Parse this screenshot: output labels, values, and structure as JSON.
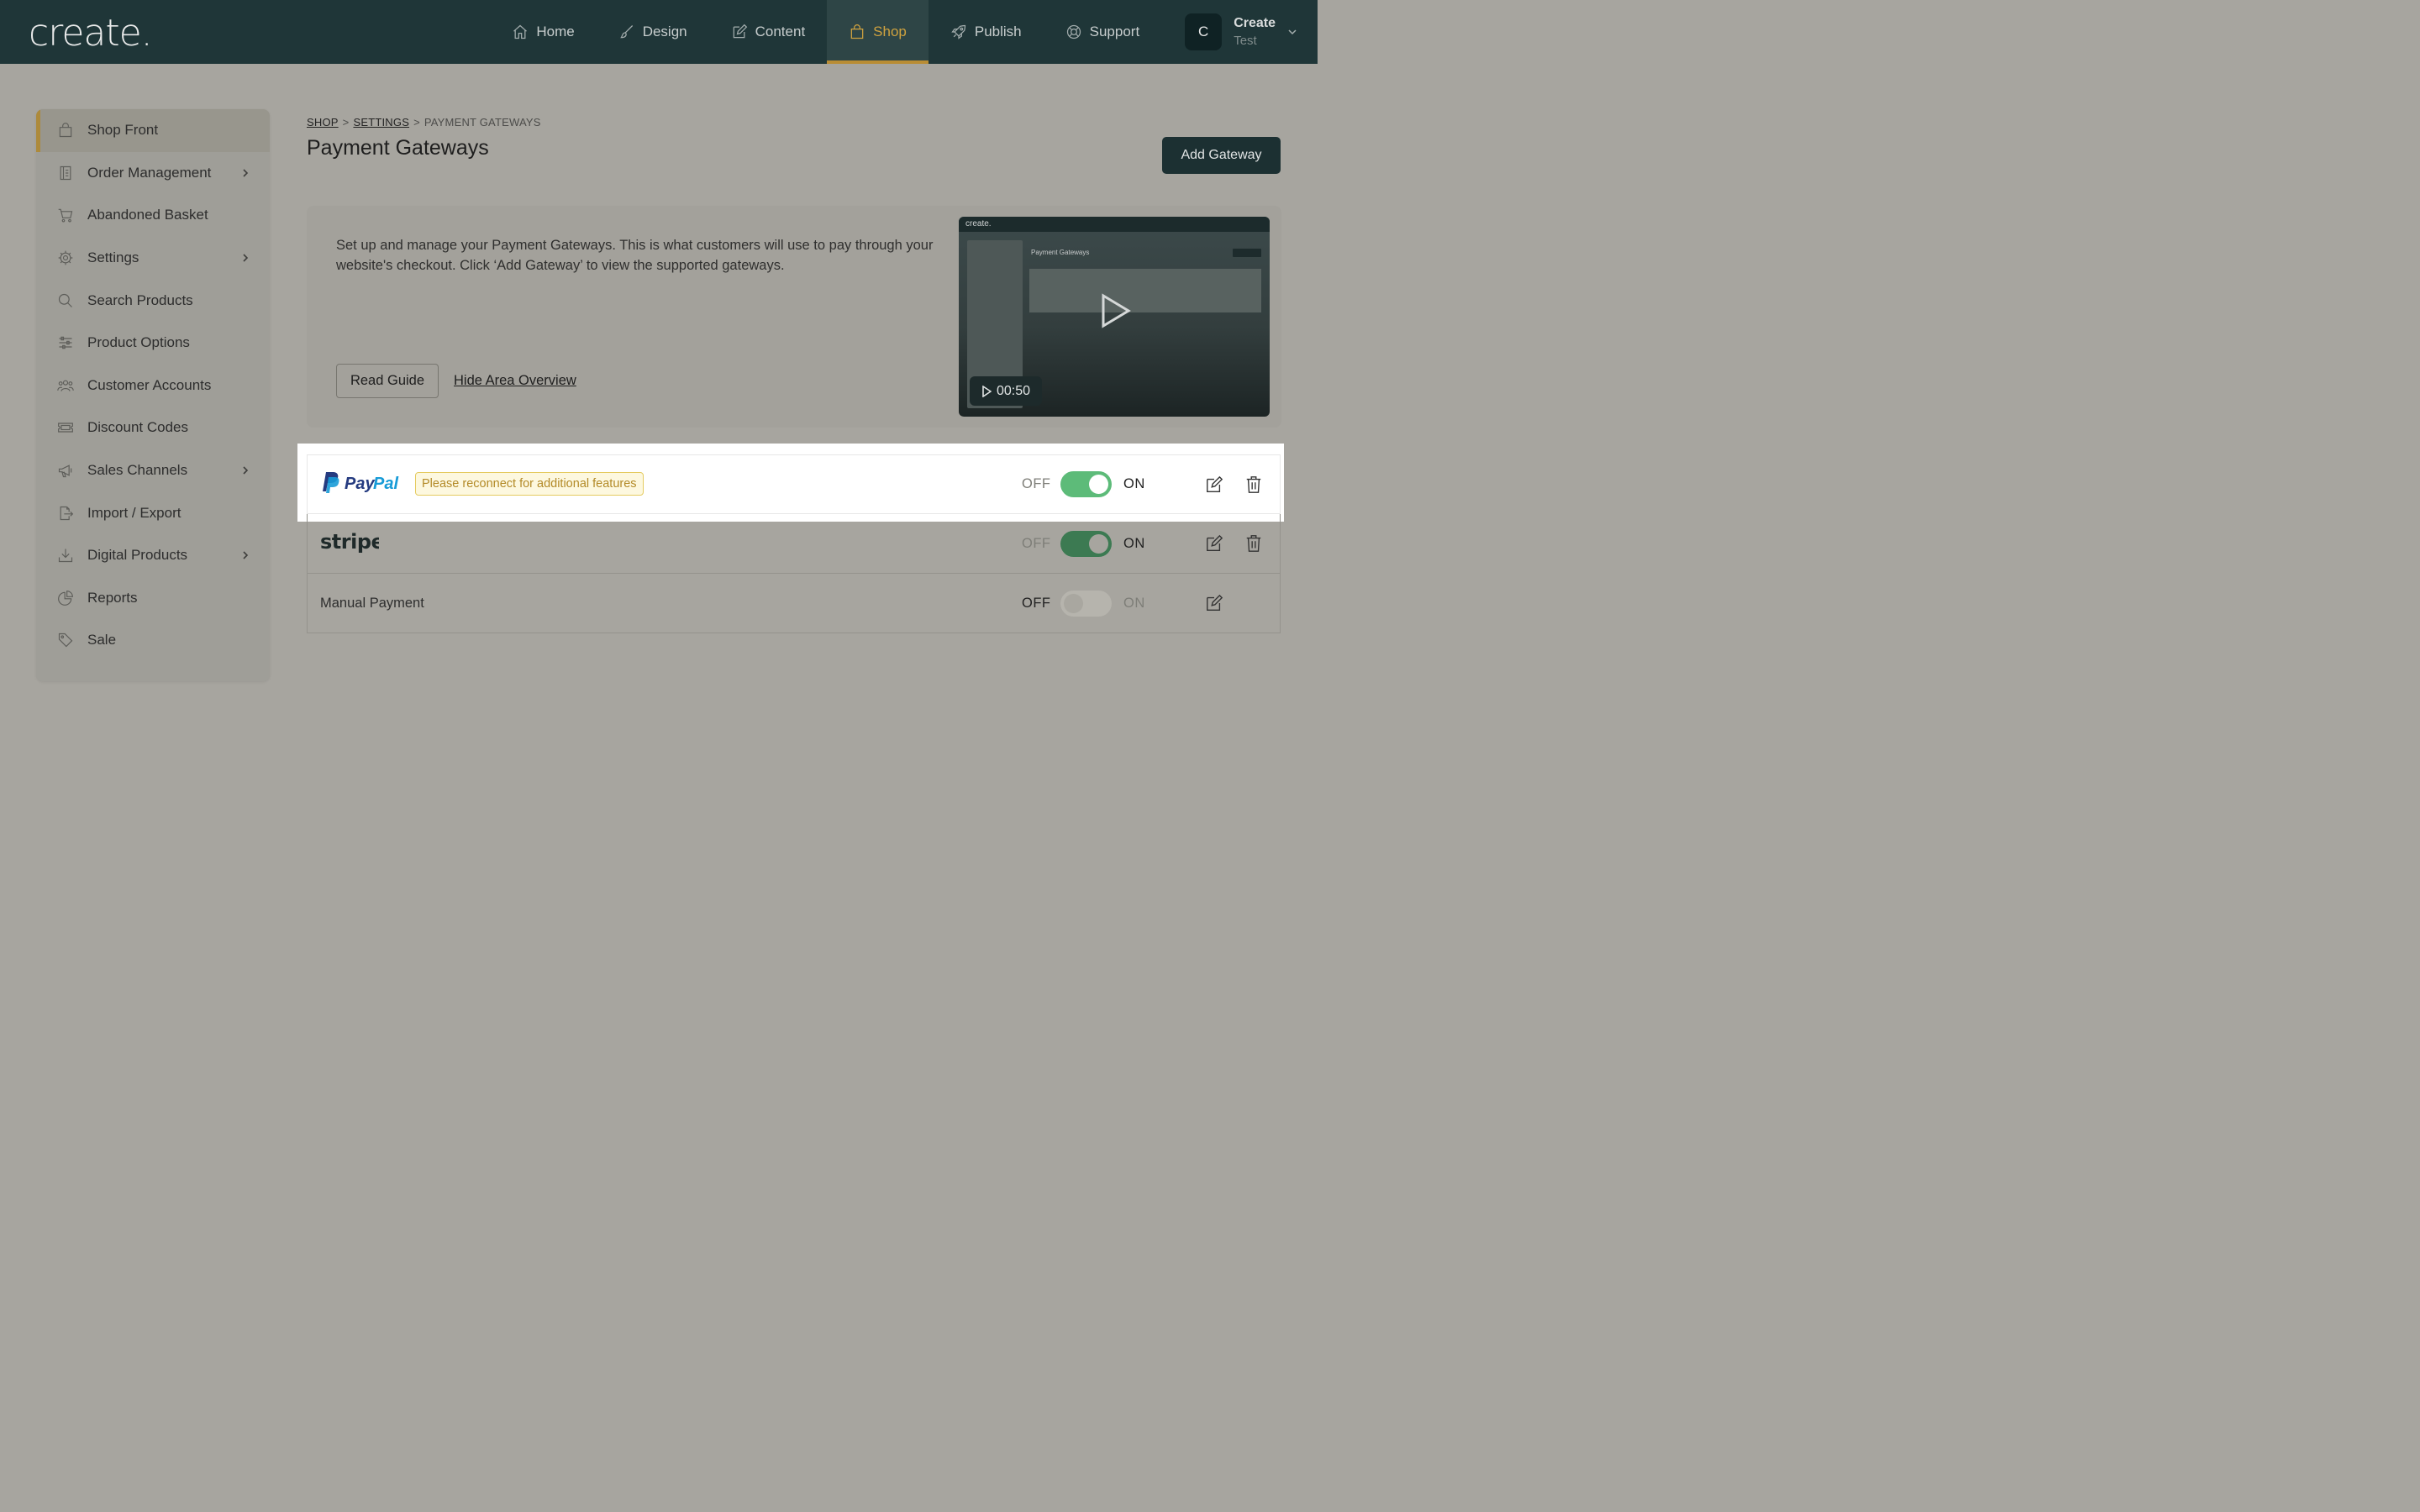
{
  "app": {
    "logo": "create."
  },
  "nav": {
    "items": [
      {
        "label": "Home",
        "icon": "home-icon"
      },
      {
        "label": "Design",
        "icon": "brush-icon"
      },
      {
        "label": "Content",
        "icon": "edit-icon"
      },
      {
        "label": "Shop",
        "icon": "shopping-bag-icon",
        "active": true
      },
      {
        "label": "Publish",
        "icon": "rocket-icon"
      },
      {
        "label": "Support",
        "icon": "lifebuoy-icon"
      }
    ],
    "account": {
      "initial": "C",
      "name": "Create",
      "sub": "Test"
    }
  },
  "sidebar": {
    "items": [
      {
        "label": "Shop Front",
        "icon": "shopping-bag-icon",
        "active": true
      },
      {
        "label": "Order Management",
        "icon": "ledger-icon",
        "chevron": true
      },
      {
        "label": "Abandoned Basket",
        "icon": "cart-icon"
      },
      {
        "label": "Settings",
        "icon": "gear-icon",
        "chevron": true
      },
      {
        "label": "Search Products",
        "icon": "search-icon"
      },
      {
        "label": "Product Options",
        "icon": "sliders-icon"
      },
      {
        "label": "Customer Accounts",
        "icon": "users-icon"
      },
      {
        "label": "Discount Codes",
        "icon": "ticket-icon"
      },
      {
        "label": "Sales Channels",
        "icon": "megaphone-icon",
        "chevron": true
      },
      {
        "label": "Import / Export",
        "icon": "file-export-icon"
      },
      {
        "label": "Digital Products",
        "icon": "download-icon",
        "chevron": true
      },
      {
        "label": "Reports",
        "icon": "pie-chart-icon"
      },
      {
        "label": "Sale",
        "icon": "tag-icon"
      }
    ]
  },
  "breadcrumb": {
    "shop": "SHOP",
    "settings": "SETTINGS",
    "current": "PAYMENT GATEWAYS",
    "sep": ">"
  },
  "page": {
    "title": "Payment Gateways",
    "add_button": "Add Gateway"
  },
  "overview": {
    "text": "Set up and manage your Payment Gateways. This is what customers will use to pay through your website's checkout. Click ‘Add Gateway’ to view the supported gateways.",
    "read_guide": "Read Guide",
    "hide_link": "Hide Area Overview",
    "video": {
      "duration": "00:50",
      "mini_logo": "create.",
      "mini_title": "Payment Gateways"
    }
  },
  "gateways": [
    {
      "name": "PayPal",
      "logo": "paypal-logo",
      "notice": "Please reconnect for additional features",
      "enabled": true,
      "off": "OFF",
      "on": "ON",
      "deletable": true,
      "highlighted": true
    },
    {
      "name": "stripe",
      "logo": "stripe-logo",
      "enabled": true,
      "off": "OFF",
      "on": "ON",
      "deletable": true
    },
    {
      "name": "Manual Payment",
      "enabled": false,
      "off": "OFF",
      "on": "ON",
      "deletable": false
    }
  ],
  "colors": {
    "topbar": "#1f3638",
    "accent": "#cfa23f",
    "toggle_on": "#5dbb79",
    "notice_text": "#b38a27"
  }
}
